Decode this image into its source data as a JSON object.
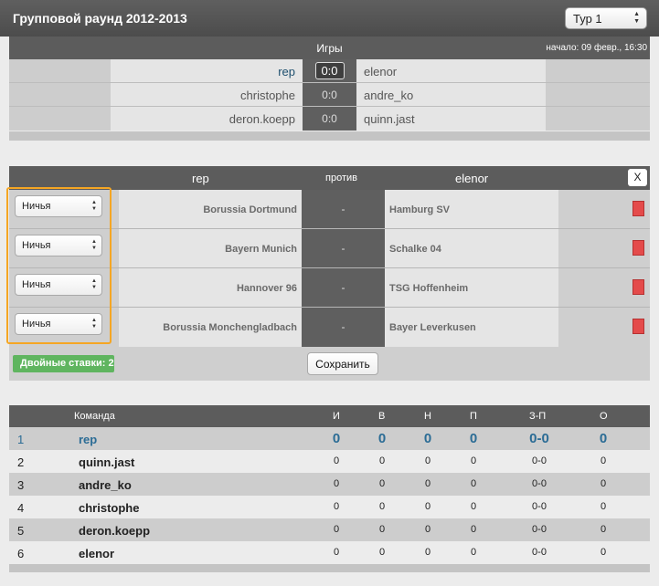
{
  "header": {
    "title": "Групповой раунд 2012-2013",
    "tour_select": "Тур 1"
  },
  "games": {
    "title": "Игры",
    "start": "начало: 09 февр., 16:30",
    "rows": [
      {
        "home": "rep",
        "score": "0:0",
        "away": "elenor"
      },
      {
        "home": "christophe",
        "score": "0:0",
        "away": "andre_ko"
      },
      {
        "home": "deron.koepp",
        "score": "0:0",
        "away": "quinn.jast"
      }
    ]
  },
  "bets": {
    "home_player": "rep",
    "vs": "против",
    "away_player": "elenor",
    "close": "X",
    "rows": [
      {
        "choice": "Ничья",
        "home": "Borussia Dortmund",
        "result": "-",
        "away": "Hamburg SV"
      },
      {
        "choice": "Ничья",
        "home": "Bayern Munich",
        "result": "-",
        "away": "Schalke 04"
      },
      {
        "choice": "Ничья",
        "home": "Hannover 96",
        "result": "-",
        "away": "TSG Hoffenheim"
      },
      {
        "choice": "Ничья",
        "home": "Borussia Monchengladbach",
        "result": "-",
        "away": "Bayer Leverkusen"
      }
    ],
    "double_bets": "Двойные ставки: 2",
    "save": "Сохранить"
  },
  "standings": {
    "columns": {
      "team": "Команда",
      "played": "И",
      "won": "В",
      "draw": "Н",
      "lost": "П",
      "goals": "З-П",
      "points": "О"
    },
    "rows": [
      {
        "rank": "1",
        "team": "rep",
        "played": "0",
        "won": "0",
        "draw": "0",
        "lost": "0",
        "goals": "0-0",
        "points": "0"
      },
      {
        "rank": "2",
        "team": "quinn.jast",
        "played": "0",
        "won": "0",
        "draw": "0",
        "lost": "0",
        "goals": "0-0",
        "points": "0"
      },
      {
        "rank": "3",
        "team": "andre_ko",
        "played": "0",
        "won": "0",
        "draw": "0",
        "lost": "0",
        "goals": "0-0",
        "points": "0"
      },
      {
        "rank": "4",
        "team": "christophe",
        "played": "0",
        "won": "0",
        "draw": "0",
        "lost": "0",
        "goals": "0-0",
        "points": "0"
      },
      {
        "rank": "5",
        "team": "deron.koepp",
        "played": "0",
        "won": "0",
        "draw": "0",
        "lost": "0",
        "goals": "0-0",
        "points": "0"
      },
      {
        "rank": "6",
        "team": "elenor",
        "played": "0",
        "won": "0",
        "draw": "0",
        "lost": "0",
        "goals": "0-0",
        "points": "0"
      }
    ]
  },
  "colors": {
    "header_bg": "#4c4c4c",
    "accent_blue": "#2b6c95",
    "badge_green": "#5fb55f",
    "highlight_orange": "#f5a623",
    "flag_red": "#e44b4b"
  },
  "icons": {
    "select_arrows": "up-down-arrows-icon",
    "flag": "red-flag-icon"
  }
}
